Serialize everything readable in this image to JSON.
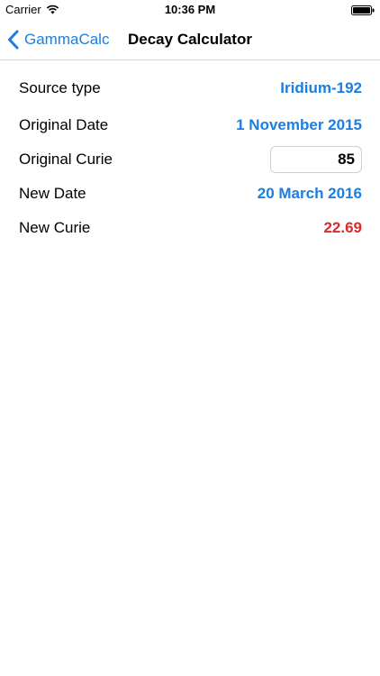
{
  "status_bar": {
    "carrier": "Carrier",
    "time": "10:36 PM",
    "wifi_icon": "wifi-icon",
    "battery_icon": "battery-icon"
  },
  "nav": {
    "back_label": "GammaCalc",
    "back_icon": "chevron-left-icon",
    "title": "Decay Calculator",
    "accent_color": "#1a7ee2"
  },
  "form": {
    "source_type": {
      "label": "Source type",
      "value": "Iridium-192"
    },
    "original_date": {
      "label": "Original Date",
      "value": "1 November 2015"
    },
    "original_curie": {
      "label": "Original Curie",
      "value": "85"
    },
    "new_date": {
      "label": "New Date",
      "value": "20 March 2016"
    },
    "new_curie": {
      "label": "New Curie",
      "value": "22.69",
      "color": "#e0282a"
    }
  }
}
